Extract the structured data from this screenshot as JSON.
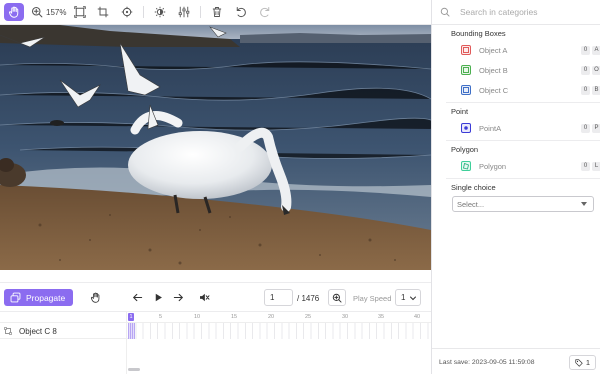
{
  "toolbar": {
    "zoom": "157%",
    "accent": "#8b6cf0"
  },
  "controls": {
    "propagate_label": "Propagate",
    "current_frame": "1",
    "total_frames": "/ 1476",
    "play_speed_label": "Play Speed",
    "speed_value": "1"
  },
  "timeline": {
    "ticks": [
      "1",
      "5",
      "10",
      "15",
      "20",
      "25",
      "30",
      "35",
      "40"
    ],
    "rows": [
      {
        "name": "Object C 8"
      }
    ]
  },
  "panel": {
    "search_placeholder": "Search in categories",
    "groups": [
      {
        "title": "Bounding Boxes",
        "items": [
          {
            "label": "Object A",
            "keys": [
              "0",
              "A"
            ],
            "color": "#e05a5a",
            "icon": "bounding-box-icon"
          },
          {
            "label": "Object B",
            "keys": [
              "0",
              "O"
            ],
            "color": "#4caf50",
            "icon": "bounding-box-icon"
          },
          {
            "label": "Object C",
            "keys": [
              "0",
              "B"
            ],
            "color": "#3f6fc6",
            "icon": "bounding-box-icon"
          }
        ]
      },
      {
        "title": "Point",
        "items": [
          {
            "label": "PointA",
            "keys": [
              "0",
              "P"
            ],
            "color": "#3b3bd6",
            "icon": "point-icon"
          }
        ]
      },
      {
        "title": "Polygon",
        "items": [
          {
            "label": "Polygon",
            "keys": [
              "0",
              "L"
            ],
            "color": "#3fcf9a",
            "icon": "polygon-icon"
          }
        ]
      },
      {
        "title": "Single choice",
        "items": []
      }
    ],
    "select_placeholder": "Select...",
    "last_save": "Last save: 2023-09-05 11:59:08",
    "tag_count": "1"
  }
}
